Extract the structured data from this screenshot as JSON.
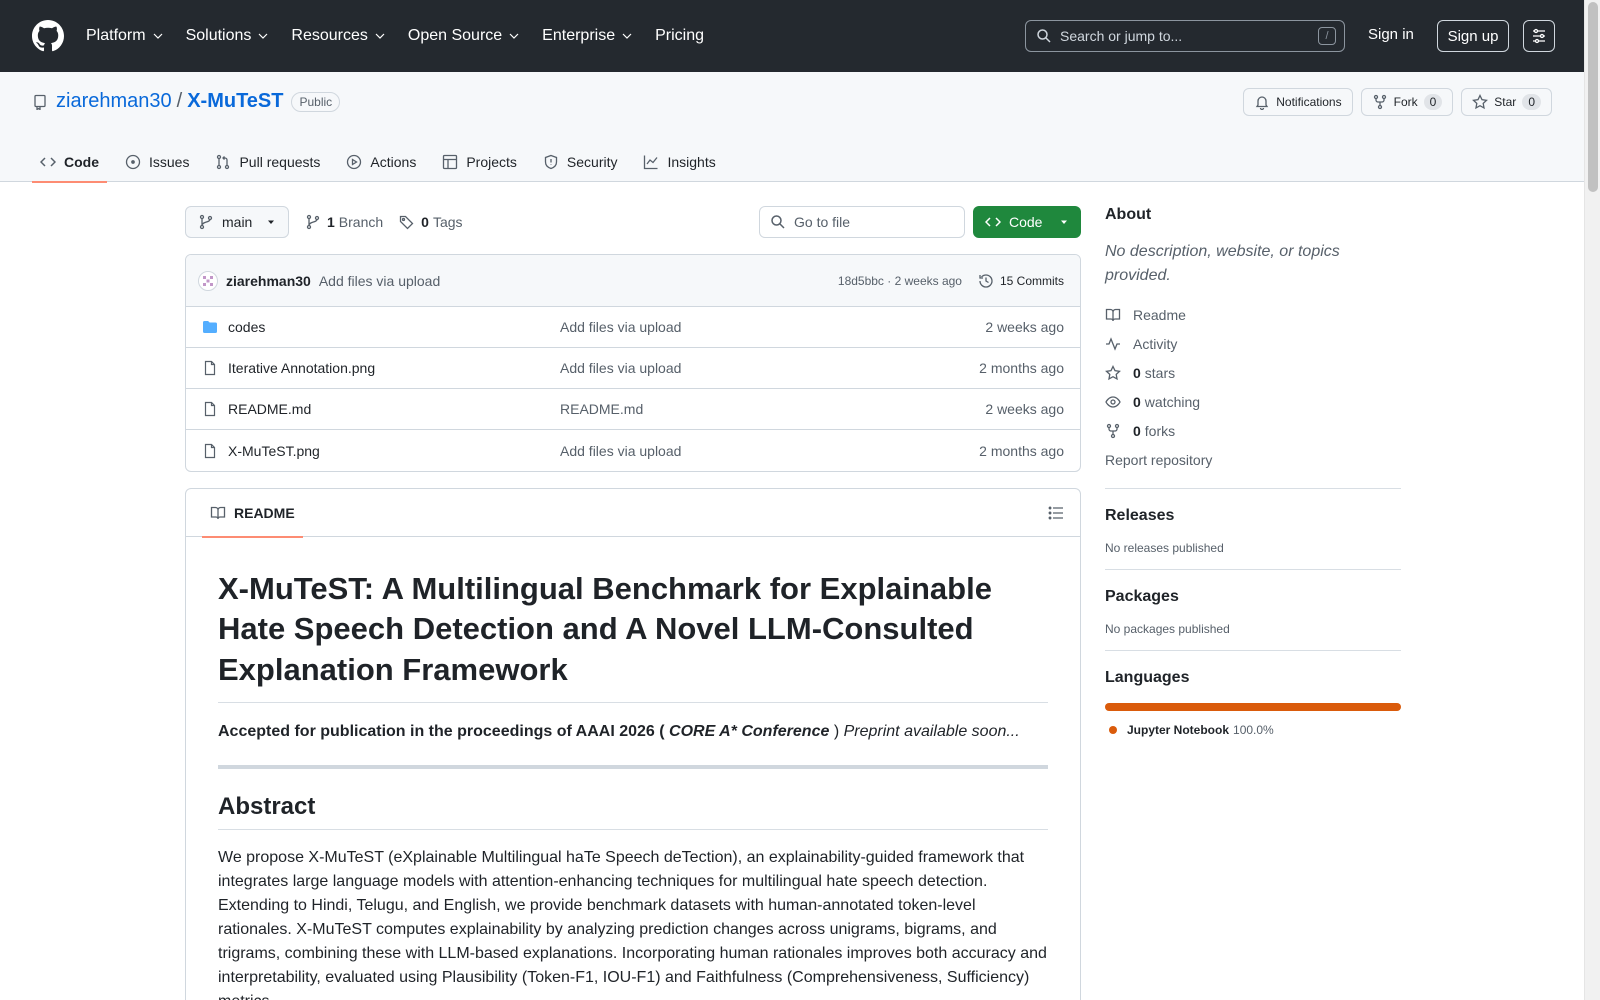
{
  "header": {
    "nav": [
      "Platform",
      "Solutions",
      "Resources",
      "Open Source",
      "Enterprise",
      "Pricing"
    ],
    "search_placeholder": "Search or jump to...",
    "search_key": "/",
    "signin": "Sign in",
    "signup": "Sign up"
  },
  "repo": {
    "owner": "ziarehman30",
    "sep": "/",
    "name": "X-MuTeST",
    "visibility": "Public",
    "notifications": "Notifications",
    "fork": "Fork",
    "fork_count": "0",
    "star": "Star",
    "star_count": "0",
    "tabs": [
      "Code",
      "Issues",
      "Pull requests",
      "Actions",
      "Projects",
      "Security",
      "Insights"
    ]
  },
  "toolbar": {
    "branch": "main",
    "branches_count": "1",
    "branches_label": "Branch",
    "tags_count": "0",
    "tags_label": "Tags",
    "goto_placeholder": "Go to file",
    "code_btn": "Code"
  },
  "commit": {
    "author": "ziarehman30",
    "message": "Add files via upload",
    "sha_time": "18d5bbc · 2 weeks ago",
    "commits": "15 Commits"
  },
  "files": [
    {
      "name": "codes",
      "type": "folder",
      "message": "Add files via upload",
      "time": "2 weeks ago"
    },
    {
      "name": "Iterative Annotation.png",
      "type": "file",
      "message": "Add files via upload",
      "time": "2 months ago"
    },
    {
      "name": "README.md",
      "type": "file",
      "message": "README.md",
      "time": "2 weeks ago"
    },
    {
      "name": "X-MuTeST.png",
      "type": "file",
      "message": "Add files via upload",
      "time": "2 months ago"
    }
  ],
  "readme": {
    "tab": "README",
    "title": "X-MuTeST: A Multilingual Benchmark for Explainable Hate Speech Detection and A Novel LLM-Consulted Explanation Framework",
    "accept_bold": "Accepted for publication in the proceedings of AAAI 2026 (",
    "accept_conf": "CORE A* Conference",
    "accept_close": ")",
    "accept_tail": "Preprint available soon...",
    "abstract_heading": "Abstract",
    "abstract": "We propose X-MuTeST (eXplainable Multilingual haTe Speech deTection), an explainability-guided framework that integrates large language models with attention-enhancing techniques for multilingual hate speech detection. Extending to Hindi, Telugu, and English, we provide benchmark datasets with human-annotated token-level rationales. X-MuTeST computes explainability by analyzing prediction changes across unigrams, bigrams, and trigrams, combining these with LLM-based explanations. Incorporating human rationales improves both accuracy and interpretability, evaluated using Plausibility (Token-F1, IOU-F1) and Faithfulness (Comprehensiveness, Sufficiency) metrics."
  },
  "sidebar": {
    "about": "About",
    "description": "No description, website, or topics provided.",
    "readme": "Readme",
    "activity": "Activity",
    "stars_count": "0",
    "stars_label": "stars",
    "watching_count": "0",
    "watching_label": "watching",
    "forks_count": "0",
    "forks_label": "forks",
    "report": "Report repository",
    "releases": "Releases",
    "releases_empty": "No releases published",
    "packages": "Packages",
    "packages_empty": "No packages published",
    "languages": "Languages",
    "lang_name": "Jupyter Notebook",
    "lang_pct": "100.0%",
    "lang_color": "#DA5B0B"
  }
}
